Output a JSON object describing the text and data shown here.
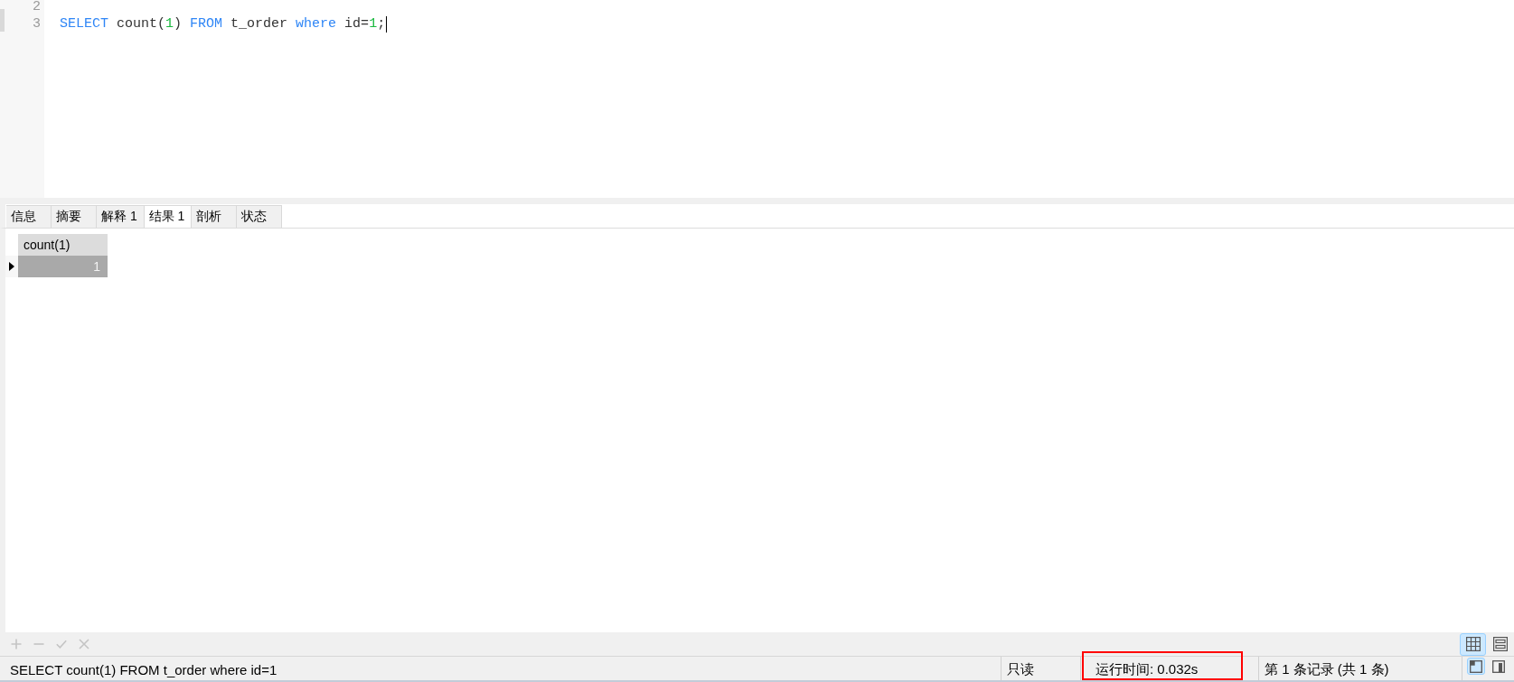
{
  "editor": {
    "lines": [
      {
        "number": "2",
        "cursor": false
      },
      {
        "number": "3",
        "tokens": [
          {
            "kind": "keyword",
            "text": "SELECT"
          },
          {
            "kind": "plain",
            "text": " count("
          },
          {
            "kind": "number",
            "text": "1"
          },
          {
            "kind": "plain",
            "text": ") "
          },
          {
            "kind": "keyword",
            "text": "FROM"
          },
          {
            "kind": "plain",
            "text": " t_order "
          },
          {
            "kind": "keyword",
            "text": "where"
          },
          {
            "kind": "plain",
            "text": " id="
          },
          {
            "kind": "number",
            "text": "1"
          },
          {
            "kind": "plain",
            "text": ";"
          }
        ],
        "cursor": true
      }
    ]
  },
  "result_tabs": [
    {
      "label": "信息",
      "selected": false
    },
    {
      "label": "摘要",
      "selected": false
    },
    {
      "label": "解释 1",
      "selected": false
    },
    {
      "label": "结果 1",
      "selected": true
    },
    {
      "label": "剖析",
      "selected": false
    },
    {
      "label": "状态",
      "selected": false
    }
  ],
  "result_grid": {
    "columns": [
      {
        "label": "count(1)"
      }
    ],
    "rows": [
      {
        "current": true,
        "selected": true,
        "cells": [
          "1"
        ]
      }
    ]
  },
  "grid_toolbar": {
    "record_buttons": [
      {
        "kind": "add",
        "disabled": true
      },
      {
        "kind": "delete",
        "disabled": true
      },
      {
        "kind": "apply",
        "disabled": true
      },
      {
        "kind": "cancel",
        "disabled": true
      }
    ],
    "view_buttons": [
      {
        "kind": "grid",
        "selected": true
      },
      {
        "kind": "form",
        "selected": false
      }
    ]
  },
  "status_bar": {
    "query": "SELECT count(1) FROM t_order where id=1",
    "segments": [
      {
        "text": "只读",
        "highlighted": false
      },
      {
        "text": "运行时间: 0.032s",
        "highlighted": true
      },
      {
        "text": "第 1 条记录 (共 1 条)",
        "highlighted": false
      }
    ],
    "view_buttons": [
      {
        "kind": "window",
        "selected": true
      },
      {
        "kind": "panel",
        "selected": false
      }
    ]
  }
}
